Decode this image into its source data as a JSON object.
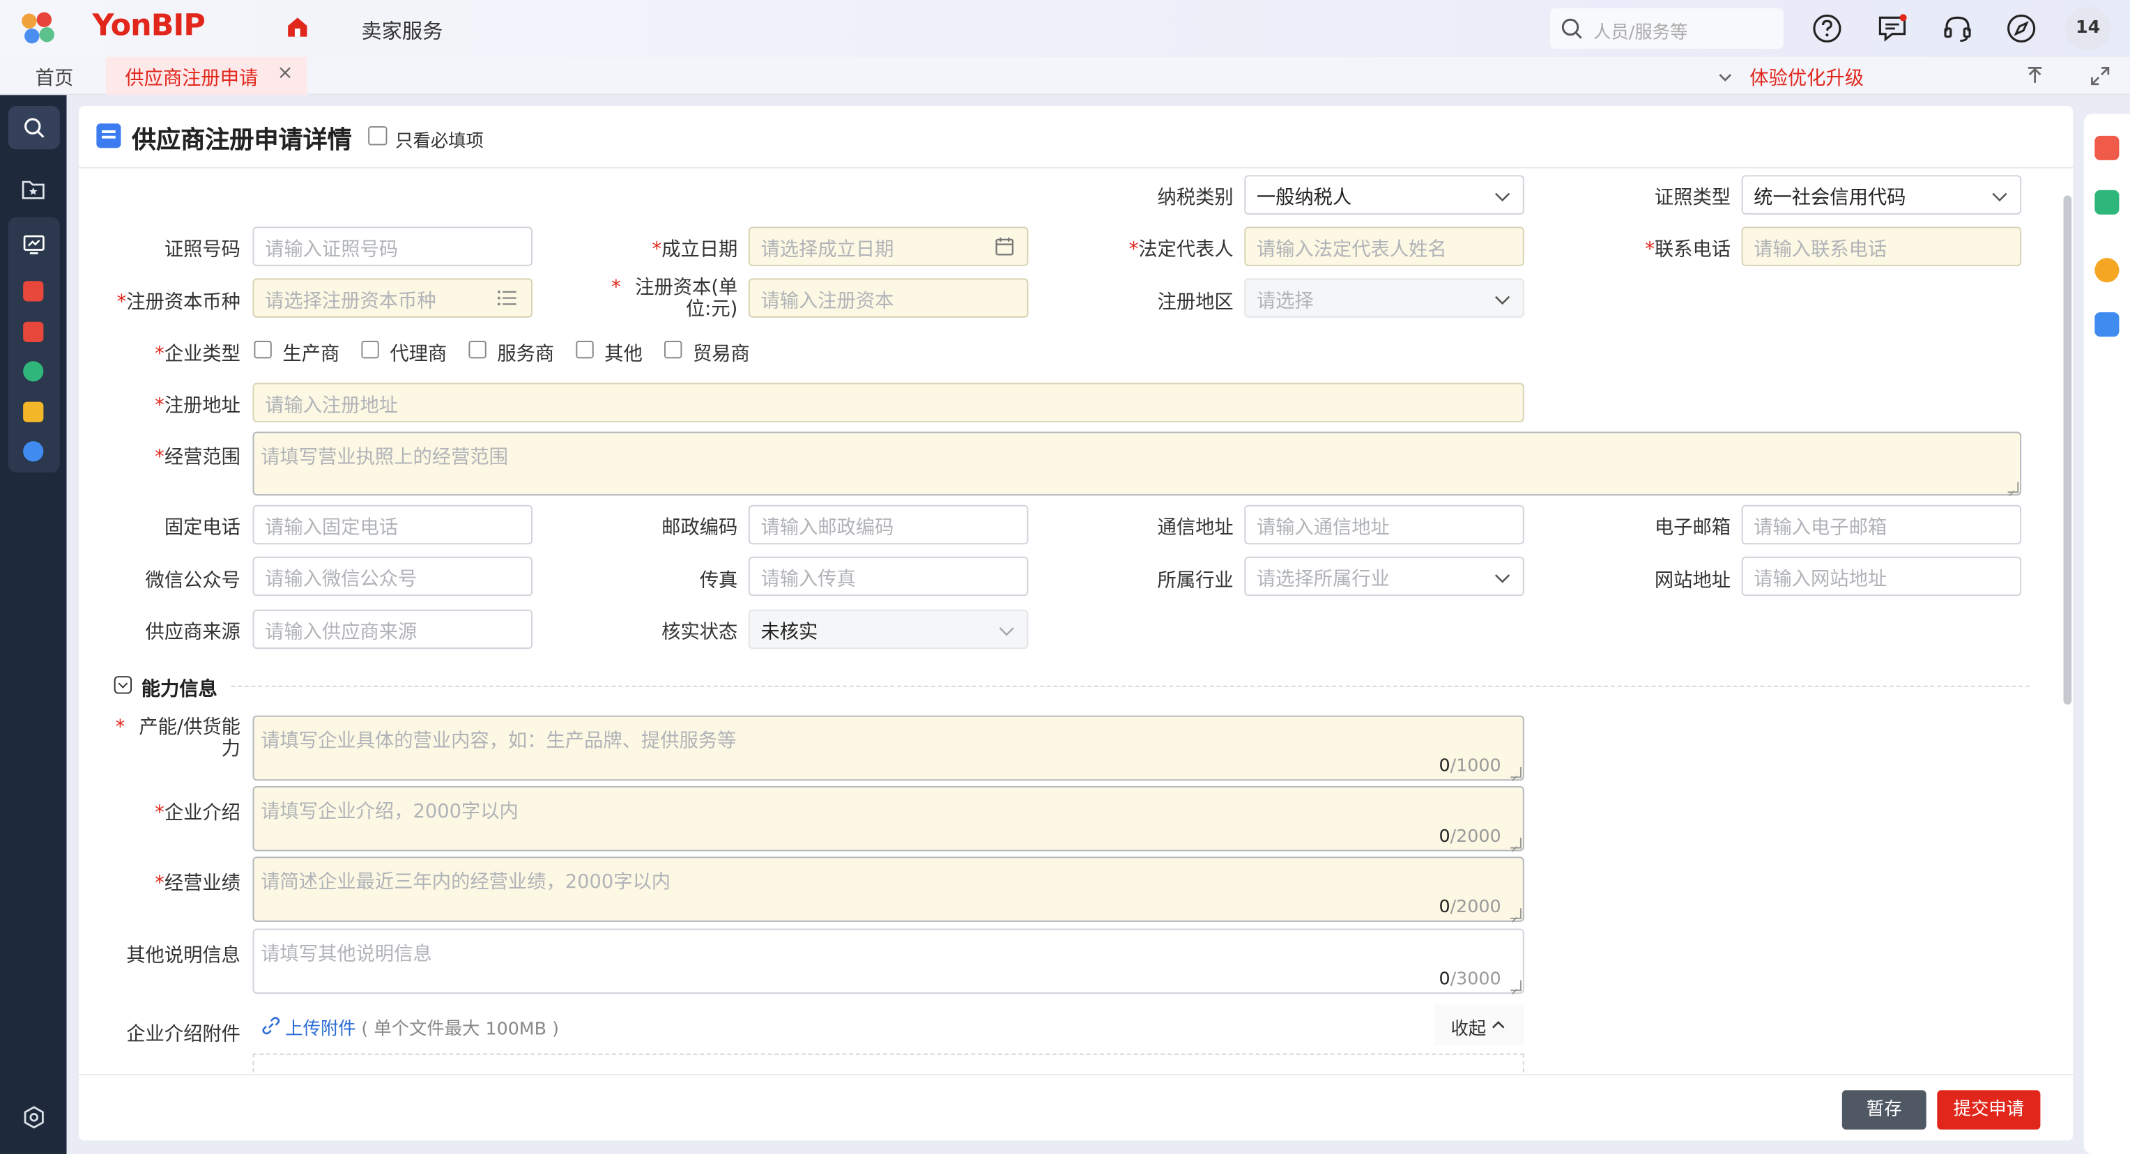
{
  "topbar": {
    "brand": "YonBIP",
    "seller_service": "卖家服务",
    "search_placeholder": "人员/服务等",
    "avatar": "14"
  },
  "tabs": {
    "home": "首页",
    "active": "供应商注册申请",
    "close": "×",
    "promo": "体验优化升级"
  },
  "card": {
    "title": "供应商注册申请详情",
    "required_only": "只看必填项"
  },
  "form": {
    "tax_type": {
      "label": "纳税类别",
      "value": "一般纳税人"
    },
    "cert_type": {
      "label": "证照类型",
      "value": "统一社会信用代码"
    },
    "cert_no": {
      "label": "证照号码",
      "placeholder": "请输入证照号码"
    },
    "found_date": {
      "label": "成立日期",
      "placeholder": "请选择成立日期"
    },
    "legal_rep": {
      "label": "法定代表人",
      "placeholder": "请输入法定代表人姓名"
    },
    "phone": {
      "label": "联系电话",
      "placeholder": "请输入联系电话"
    },
    "currency": {
      "label": "注册资本币种",
      "placeholder": "请选择注册资本币种"
    },
    "capital": {
      "label_line1": "注册资本(单",
      "label_line2": "位:元)",
      "placeholder": "请输入注册资本"
    },
    "region": {
      "label": "注册地区",
      "placeholder": "请选择"
    },
    "company_type": {
      "label": "企业类型",
      "options": [
        "生产商",
        "代理商",
        "服务商",
        "其他",
        "贸易商"
      ]
    },
    "reg_address": {
      "label": "注册地址",
      "placeholder": "请输入注册地址"
    },
    "scope": {
      "label": "经营范围",
      "placeholder": "请填写营业执照上的经营范围"
    },
    "landline": {
      "label": "固定电话",
      "placeholder": "请输入固定电话"
    },
    "postcode": {
      "label": "邮政编码",
      "placeholder": "请输入邮政编码"
    },
    "mail_address": {
      "label": "通信地址",
      "placeholder": "请输入通信地址"
    },
    "email": {
      "label": "电子邮箱",
      "placeholder": "请输入电子邮箱"
    },
    "wechat": {
      "label": "微信公众号",
      "placeholder": "请输入微信公众号"
    },
    "fax": {
      "label": "传真",
      "placeholder": "请输入传真"
    },
    "industry": {
      "label": "所属行业",
      "placeholder": "请选择所属行业"
    },
    "website": {
      "label": "网站地址",
      "placeholder": "请输入网站地址"
    },
    "source": {
      "label": "供应商来源",
      "placeholder": "请输入供应商来源"
    },
    "verify": {
      "label": "核实状态",
      "value": "未核实"
    }
  },
  "ability": {
    "section_title": "能力信息",
    "capacity": {
      "label_line1": "产能/供货能",
      "label_line2": "力",
      "placeholder": "请填写企业具体的营业内容，如：生产品牌、提供服务等",
      "count": "0",
      "max": "/1000"
    },
    "intro": {
      "label": "企业介绍",
      "placeholder": "请填写企业介绍，2000字以内",
      "count": "0",
      "max": "/2000"
    },
    "performance": {
      "label": "经营业绩",
      "placeholder": "请简述企业最近三年内的经营业绩，2000字以内",
      "count": "0",
      "max": "/2000"
    },
    "other": {
      "label": "其他说明信息",
      "placeholder": "请填写其他说明信息",
      "count": "0",
      "max": "/3000"
    },
    "attachment": {
      "label": "企业介绍附件",
      "upload": "上传附件",
      "note": "( 单个文件最大 100MB )",
      "collapse": "收起"
    }
  },
  "footer": {
    "save": "暂存",
    "submit": "提交申请"
  }
}
